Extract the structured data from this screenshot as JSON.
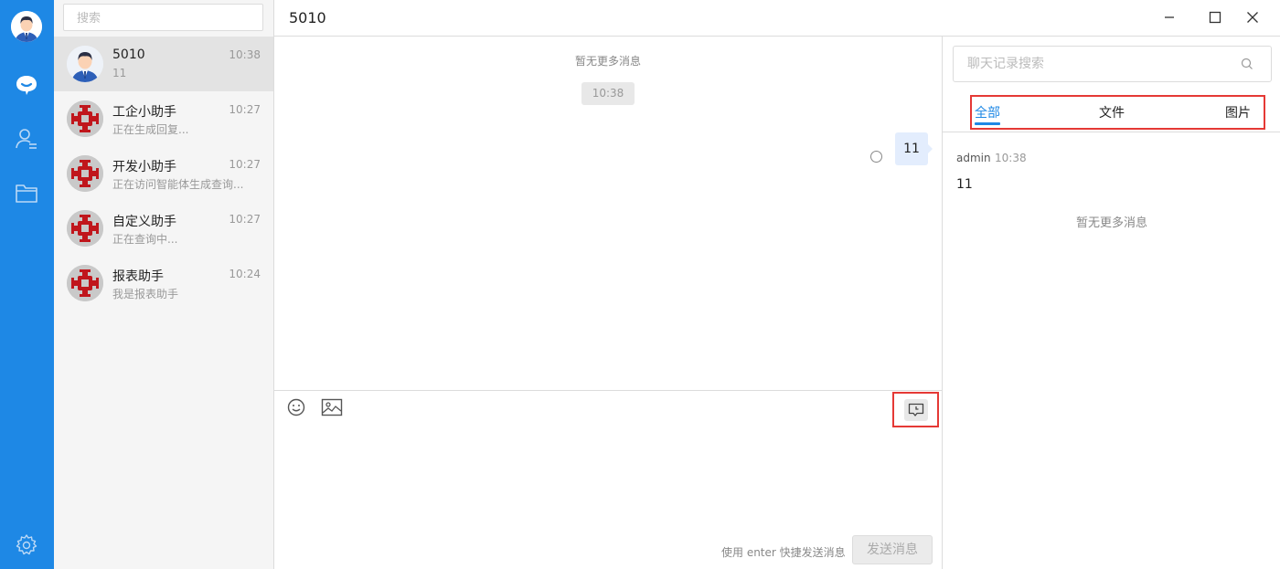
{
  "colors": {
    "rail": "#1e88e5",
    "accent": "#1e88e5",
    "highlight_border": "#e53935",
    "bubble_self": "#e3edfd"
  },
  "sidebar": {
    "search_placeholder": "搜索",
    "nav": [
      {
        "icon": "chat-icon",
        "active": true
      },
      {
        "icon": "contacts-icon",
        "active": false
      },
      {
        "icon": "folder-icon",
        "active": false
      }
    ],
    "bottom_icon": "settings-icon"
  },
  "conversations": [
    {
      "name": "5010",
      "time": "10:38",
      "preview": "11",
      "avatar": "user-avatar",
      "active": true
    },
    {
      "name": "工企小助手",
      "time": "10:27",
      "preview": "正在生成回复...",
      "avatar": "bot-avatar",
      "active": false
    },
    {
      "name": "开发小助手",
      "time": "10:27",
      "preview": "正在访问智能体生成查询...",
      "avatar": "bot-avatar",
      "active": false
    },
    {
      "name": "自定义助手",
      "time": "10:27",
      "preview": "正在查询中...",
      "avatar": "bot-avatar",
      "active": false
    },
    {
      "name": "报表助手",
      "time": "10:24",
      "preview": "我是报表助手",
      "avatar": "bot-avatar",
      "active": false
    }
  ],
  "chat": {
    "title": "5010",
    "no_more_messages": "暂无更多消息",
    "time_divider": "10:38",
    "messages": [
      {
        "text": "11",
        "from_self": true
      }
    ]
  },
  "composer": {
    "emoji_icon": "emoji-icon",
    "image_icon": "image-icon",
    "history_icon": "chat-history-icon",
    "hint": "使用 enter 快捷发送消息",
    "send_label": "发送消息"
  },
  "window_controls": [
    "minimize-icon",
    "maximize-icon",
    "close-icon"
  ],
  "history_panel": {
    "search_placeholder": "聊天记录搜索",
    "tabs": [
      "全部",
      "文件",
      "图片"
    ],
    "active_tab": 0,
    "entries": [
      {
        "sender": "admin",
        "time": "10:38",
        "text": "11"
      }
    ],
    "no_more": "暂无更多消息"
  }
}
